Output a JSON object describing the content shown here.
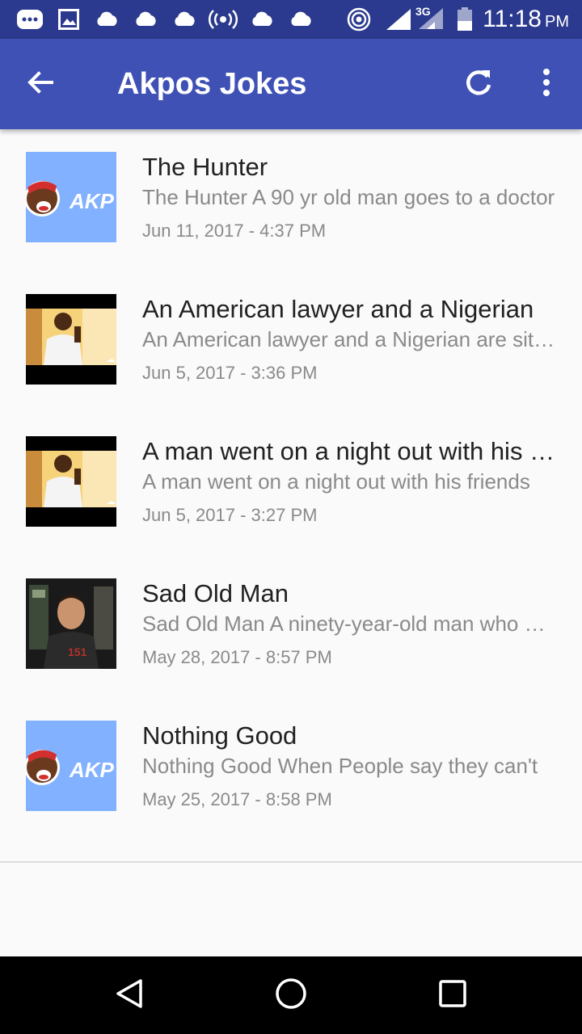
{
  "status_bar": {
    "time": "11:18",
    "ampm": "PM",
    "network": "3G",
    "icons": [
      "messenger-icon",
      "gallery-icon",
      "cloud-icon",
      "cloud-icon",
      "cloud-icon",
      "broadcast-icon",
      "cloud-icon",
      "cloud-icon",
      "hotspot-icon",
      "signal-icon",
      "signal-icon",
      "battery-icon"
    ]
  },
  "appbar": {
    "title": "Akpos Jokes",
    "back_icon": "arrow-back-icon",
    "refresh_icon": "refresh-icon",
    "menu_icon": "more-vert-icon",
    "color": "#3f51b5",
    "status_color": "#2b3a8e"
  },
  "jokes": [
    {
      "title": "The Hunter",
      "snippet": "The Hunter A 90 yr old man goes to a doctor",
      "date": "Jun 11, 2017 - 4:37 PM",
      "thumb": "akpos-logo",
      "thumb_text": "AKP"
    },
    {
      "title": "An American lawyer and a Nigerian",
      "snippet": "An American lawyer and a Nigerian are sitting",
      "date": "Jun 5, 2017 - 3:36 PM",
      "thumb": "video-still"
    },
    {
      "title": "A man went on a night out with his friends",
      "snippet": "A man went on a night out with his friends",
      "date": "Jun 5, 2017 - 3:27 PM",
      "thumb": "video-still"
    },
    {
      "title": "Sad Old Man",
      "snippet": "Sad Old Man A ninety-year-old man who was sad",
      "date": "May 28, 2017 - 8:57 PM",
      "thumb": "man-photo"
    },
    {
      "title": "Nothing Good",
      "snippet": "Nothing Good When People say they can't",
      "date": "May 25, 2017 - 8:58 PM",
      "thumb": "akpos-logo",
      "thumb_text": "AKP"
    }
  ],
  "nav_bar": {
    "back": "nav-back-icon",
    "home": "nav-home-icon",
    "recents": "nav-recents-icon"
  }
}
